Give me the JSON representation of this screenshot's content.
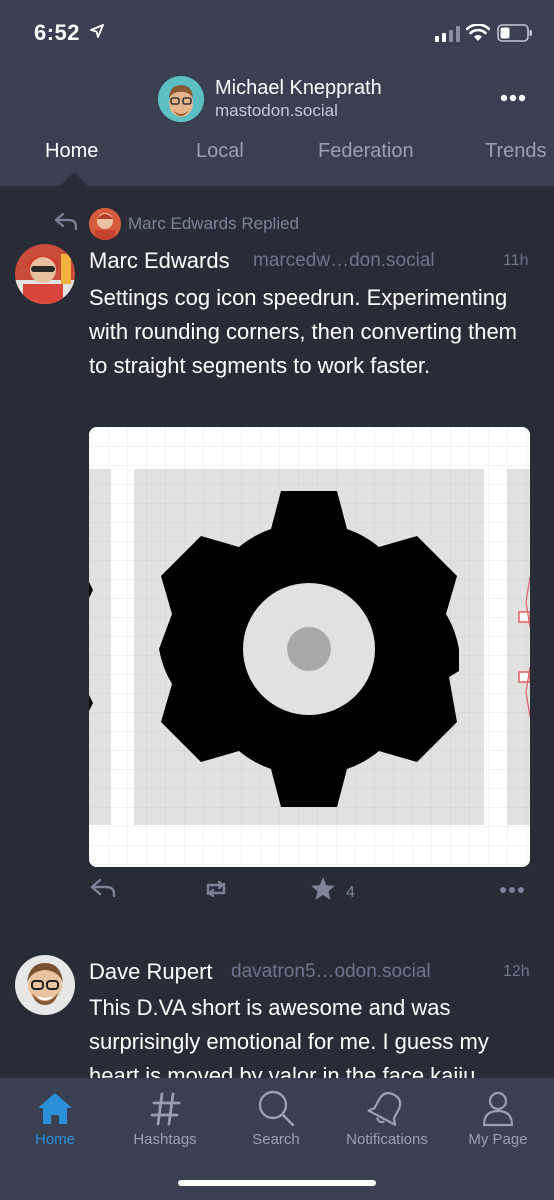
{
  "status_bar": {
    "time": "6:52"
  },
  "account": {
    "name": "Michael Knepprath",
    "domain": "mastodon.social"
  },
  "timeline_tabs": [
    {
      "label": "Home",
      "active": true
    },
    {
      "label": "Local",
      "active": false
    },
    {
      "label": "Federation",
      "active": false
    },
    {
      "label": "Trends",
      "active": false
    }
  ],
  "posts": [
    {
      "reply_indicator": "Marc Edwards Replied",
      "author": "Marc Edwards",
      "handle": "marcedw…don.social",
      "time": "11h",
      "text": "Settings cog icon speedrun. Experimenting with rounding corners, then converting them to straight segments to work faster.",
      "favourites": "4"
    },
    {
      "author": "Dave Rupert",
      "handle": "davatron5…odon.social",
      "time": "12h",
      "text": "This D.VA short is awesome and was surprisingly emotional for me. I guess my heart is moved by valor in the face kaiju"
    }
  ],
  "tabbar": [
    {
      "label": "Home",
      "icon": "home-icon",
      "active": true
    },
    {
      "label": "Hashtags",
      "icon": "hashtag-icon",
      "active": false
    },
    {
      "label": "Search",
      "icon": "search-icon",
      "active": false
    },
    {
      "label": "Notifications",
      "icon": "bell-icon",
      "active": false
    },
    {
      "label": "My Page",
      "icon": "person-icon",
      "active": false
    }
  ],
  "colors": {
    "background": "#282c37",
    "header": "#3a3f51",
    "accent": "#2b90d9",
    "muted": "#9aa0b3"
  }
}
